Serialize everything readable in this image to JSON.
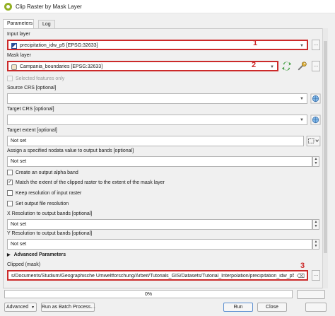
{
  "window": {
    "title": "Clip Raster by Mask Layer"
  },
  "tabs": [
    {
      "label": "Parameters"
    },
    {
      "label": "Log"
    }
  ],
  "params": {
    "input_layer": {
      "label": "Input layer",
      "value": "precipitation_idw_p5 [EPSG:32633]",
      "icon": "raster-layer-icon",
      "marker": "1"
    },
    "mask_layer": {
      "label": "Mask layer",
      "value": "Campania_boundaries [EPSG:32633]",
      "icon": "polygon-layer-icon",
      "marker": "2"
    },
    "selected_only": {
      "label": "Selected features only",
      "checked": false
    },
    "source_crs": {
      "label": "Source CRS [optional]",
      "value": ""
    },
    "target_crs": {
      "label": "Target CRS [optional]",
      "value": ""
    },
    "target_extent": {
      "label": "Target extent [optional]",
      "value": "Not set"
    },
    "nodata": {
      "label": "Assign a specified nodata value to output bands [optional]",
      "value": "Not set"
    },
    "alpha_band": {
      "label": "Create an output alpha band",
      "checked": false
    },
    "match_extent": {
      "label": "Match the extent of the clipped raster to the extent of the mask layer",
      "checked": true
    },
    "keep_resolution": {
      "label": "Keep resolution of input raster",
      "checked": false
    },
    "set_resolution": {
      "label": "Set output file resolution",
      "checked": false
    },
    "x_res": {
      "label": "X Resolution to output bands [optional]",
      "value": "Not set"
    },
    "y_res": {
      "label": "Y Resolution to output bands [optional]",
      "value": "Not set"
    },
    "advanced": {
      "label": "Advanced Parameters"
    },
    "clipped": {
      "label": "Clipped (mask)",
      "value": "s/Documents/Studium/Geographische Umweltforschung/Arbeit/Tutorials_GIS/Datasets/Tutorial_Interpolation/precipitation_idw_p5_clip.tif",
      "marker": "3"
    }
  },
  "footer": {
    "progress_text": "0%",
    "progress": 0,
    "advanced_button": "Advanced",
    "batch_button": "Run as Batch Process…",
    "run_button": "Run",
    "close_button": "Close"
  },
  "colors": {
    "highlight": "#cc2a2a",
    "qgis_green": "#93b023"
  }
}
